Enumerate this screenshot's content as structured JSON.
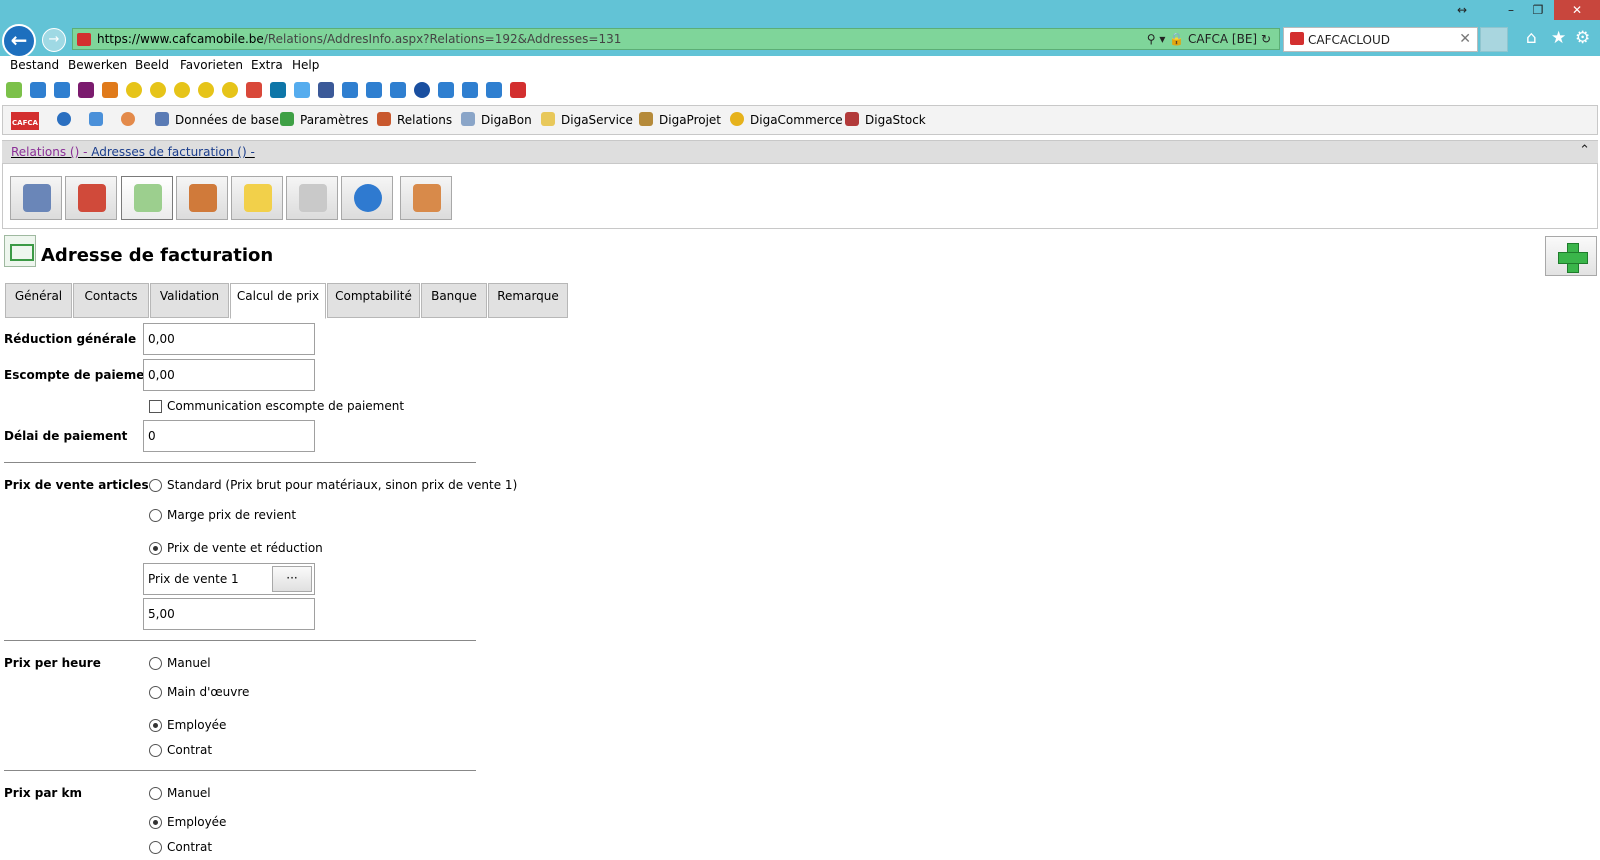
{
  "browser": {
    "url_host": "https://www.cafcamobile.be",
    "url_path": "/Relations/AddresInfo.aspx?Relations=192&Addresses=131",
    "site_identity": "CAFCA [BE]",
    "tab_title": "CAFCACLOUD"
  },
  "menu": [
    "Bestand",
    "Bewerken",
    "Beeld",
    "Favorieten",
    "Extra",
    "Help"
  ],
  "app_toolbar": {
    "items": [
      "Données de base",
      "Paramètres",
      "Relations",
      "DigaBon",
      "DigaService",
      "DigaProjet",
      "DigaCommerce",
      "DigaStock"
    ],
    "logo": "CAFCA"
  },
  "breadcrumb": {
    "part1": "Relations () - ",
    "part2": "Adresses de facturation () -"
  },
  "page": {
    "title": "Adresse de facturation"
  },
  "tabs": [
    "Général",
    "Contacts",
    "Validation",
    "Calcul de prix",
    "Comptabilité",
    "Banque",
    "Remarque"
  ],
  "form": {
    "reduction_label": "Réduction générale",
    "reduction_value": "0,00",
    "escompte_label": "Escompte de paiement",
    "escompte_value": "0,00",
    "communication_label": "Communication escompte de paiement",
    "delai_label": "Délai de paiement",
    "delai_value": "0",
    "prix_vente_label": "Prix de vente articles",
    "prix_vente_options": [
      "Standard (Prix brut pour matériaux, sinon prix de vente 1)",
      "Marge prix de revient",
      "Prix de vente et réduction"
    ],
    "prix_vente_select": "Prix de vente 1",
    "browse_label": "···",
    "prix_vente_reduction": "5,00",
    "prix_heure_label": "Prix per heure",
    "prix_heure_options": [
      "Manuel",
      "Main d'œuvre",
      "Employée",
      "Contrat"
    ],
    "prix_km_label": "Prix par km",
    "prix_km_options": [
      "Manuel",
      "Employée",
      "Contrat"
    ]
  }
}
